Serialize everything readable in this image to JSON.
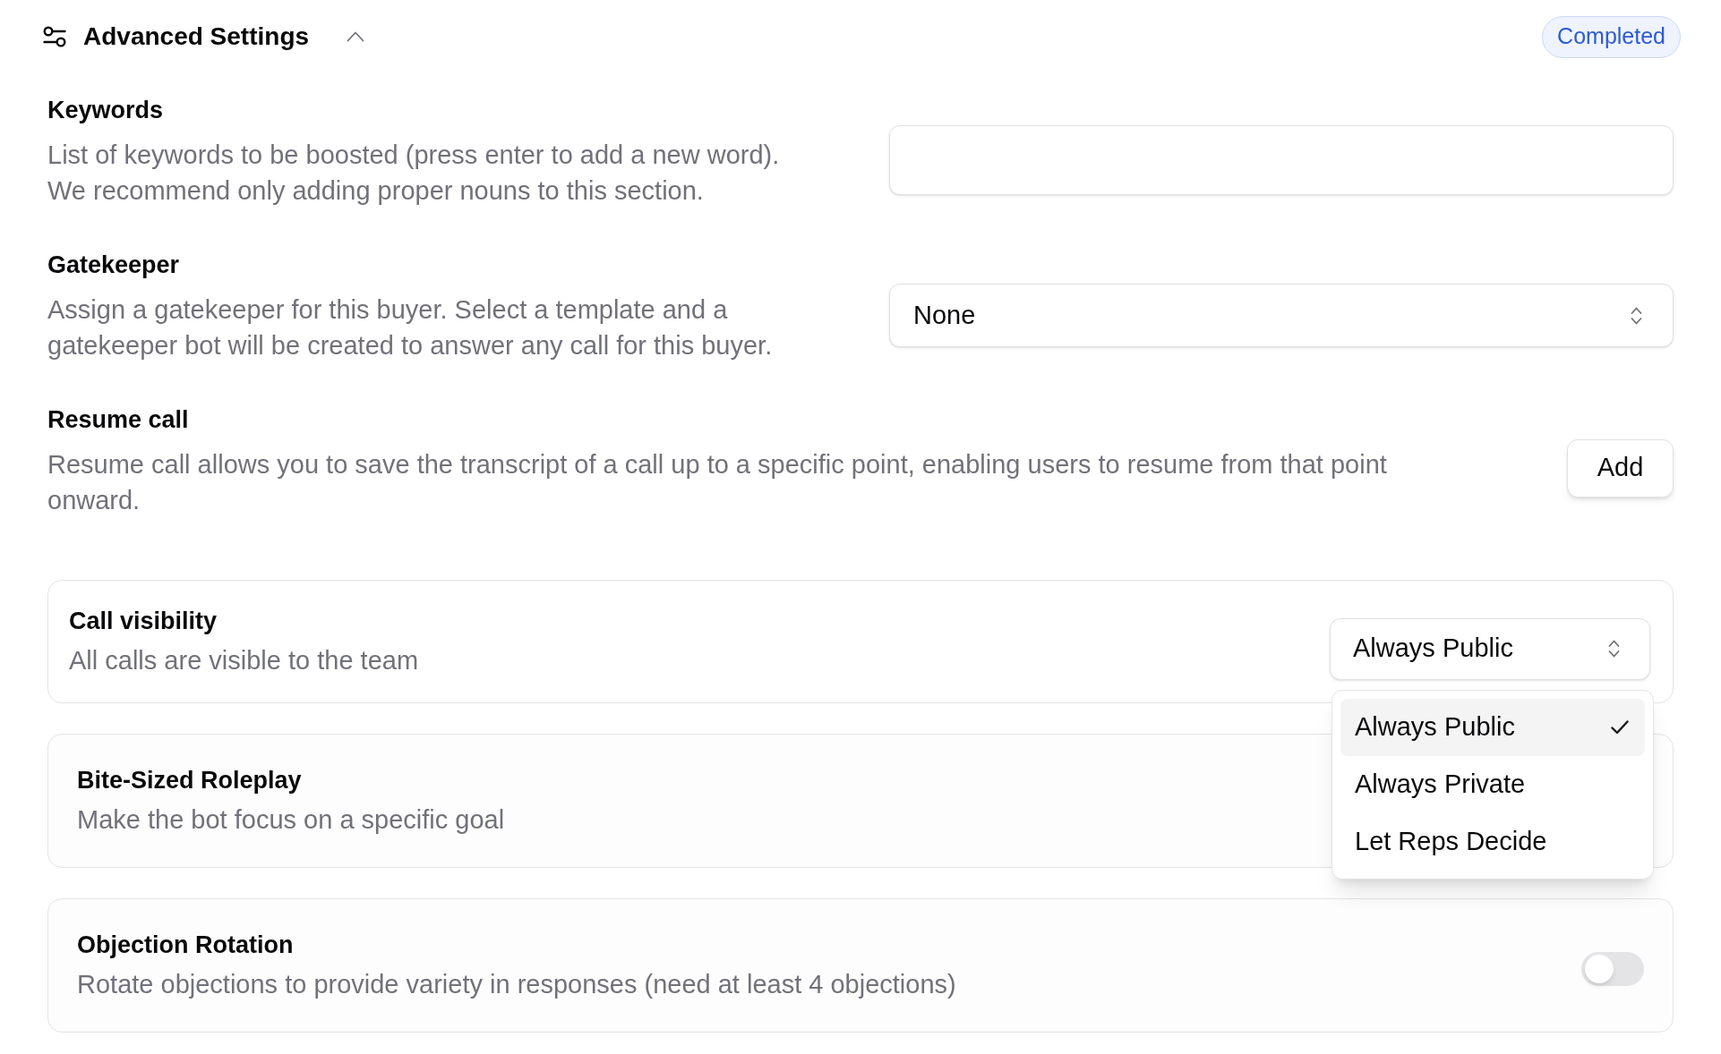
{
  "header": {
    "title": "Advanced Settings",
    "expanded": true,
    "status": "Completed"
  },
  "fields": [
    {
      "kind": "text_input",
      "title": "Keywords",
      "description": "List of keywords to be boosted (press enter to add a new word). We recommend only adding proper nouns to this section."
    },
    {
      "kind": "select",
      "title": "Gatekeeper",
      "description": "Assign a gatekeeper for this buyer. Select a template and a gatekeeper bot will be created to answer any call for this buyer.",
      "value": "None"
    },
    {
      "kind": "button",
      "title": "Resume call",
      "description": "Resume call allows you to save the transcript of a call up to a specific point, enabling users to resume from that point onward.",
      "button": "Add"
    }
  ],
  "cards": [
    {
      "kind": "select",
      "title": "Call visibility",
      "description": "All calls are visible to the team",
      "value": "Always Public",
      "expanded": true,
      "options": [
        {
          "label": "Always Public",
          "selected": true
        },
        {
          "label": "Always Private",
          "selected": false
        },
        {
          "label": "Let Reps Decide",
          "selected": false
        }
      ]
    },
    {
      "kind": "plain",
      "title": "Bite-Sized Roleplay",
      "description": "Make the bot focus on a specific goal"
    },
    {
      "kind": "toggle",
      "title": "Objection Rotation",
      "description": "Rotate objections to provide variety in responses (need at least 4 objections)",
      "on": false
    }
  ]
}
